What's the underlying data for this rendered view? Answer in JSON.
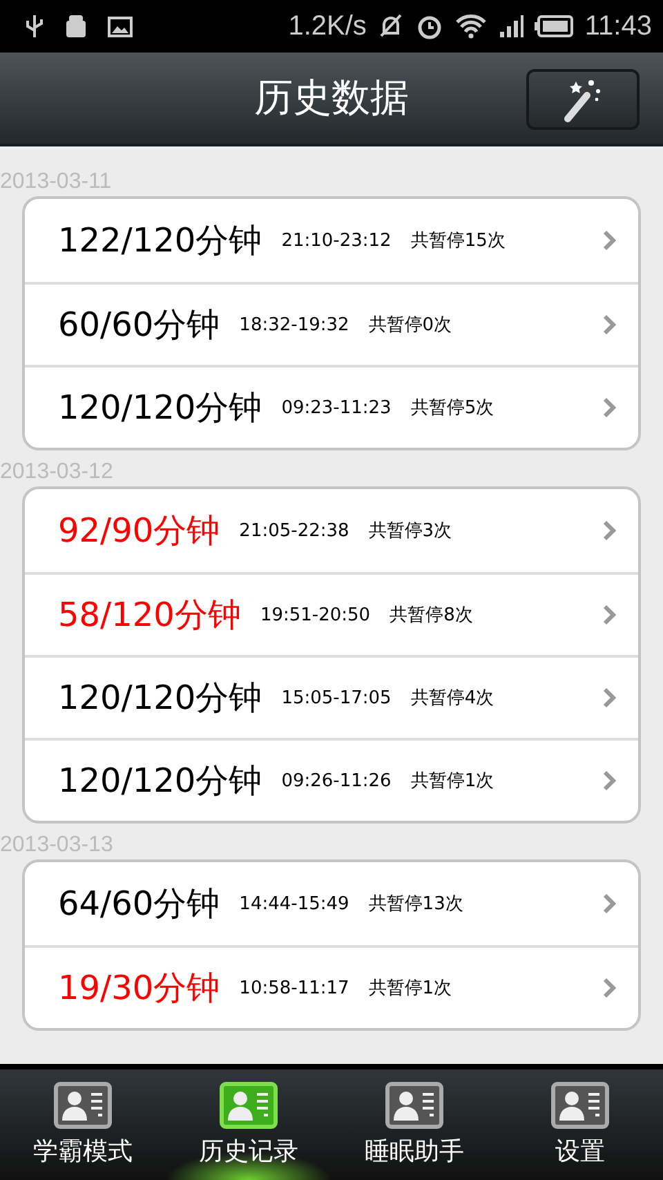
{
  "status_bar": {
    "speed": "1.2K/s",
    "time": "11:43"
  },
  "header": {
    "title": "历史数据"
  },
  "groups": [
    {
      "date": "2013-03-11",
      "records": [
        {
          "duration": "122/120分钟",
          "range": "21:10-23:12",
          "pauses": "共暂停15次",
          "color": "#000000"
        },
        {
          "duration": "60/60分钟",
          "range": "18:32-19:32",
          "pauses": "共暂停0次",
          "color": "#000000"
        },
        {
          "duration": "120/120分钟",
          "range": "09:23-11:23",
          "pauses": "共暂停5次",
          "color": "#000000"
        }
      ]
    },
    {
      "date": "2013-03-12",
      "records": [
        {
          "duration": "92/90分钟",
          "range": "21:05-22:38",
          "pauses": "共暂停3次",
          "color": "#ff0000"
        },
        {
          "duration": "58/120分钟",
          "range": "19:51-20:50",
          "pauses": "共暂停8次",
          "color": "#ff0000"
        },
        {
          "duration": "120/120分钟",
          "range": "15:05-17:05",
          "pauses": "共暂停4次",
          "color": "#000000"
        },
        {
          "duration": "120/120分钟",
          "range": "09:26-11:26",
          "pauses": "共暂停1次",
          "color": "#000000"
        }
      ]
    },
    {
      "date": "2013-03-13",
      "records": [
        {
          "duration": "64/60分钟",
          "range": "14:44-15:49",
          "pauses": "共暂停13次",
          "color": "#000000"
        },
        {
          "duration": "19/30分钟",
          "range": "10:58-11:17",
          "pauses": "共暂停1次",
          "color": "#ff0000"
        }
      ]
    }
  ],
  "tabs": [
    {
      "label": "学霸模式",
      "selected": false
    },
    {
      "label": "历史记录",
      "selected": true
    },
    {
      "label": "睡眠助手",
      "selected": false
    },
    {
      "label": "设置",
      "selected": false
    }
  ]
}
